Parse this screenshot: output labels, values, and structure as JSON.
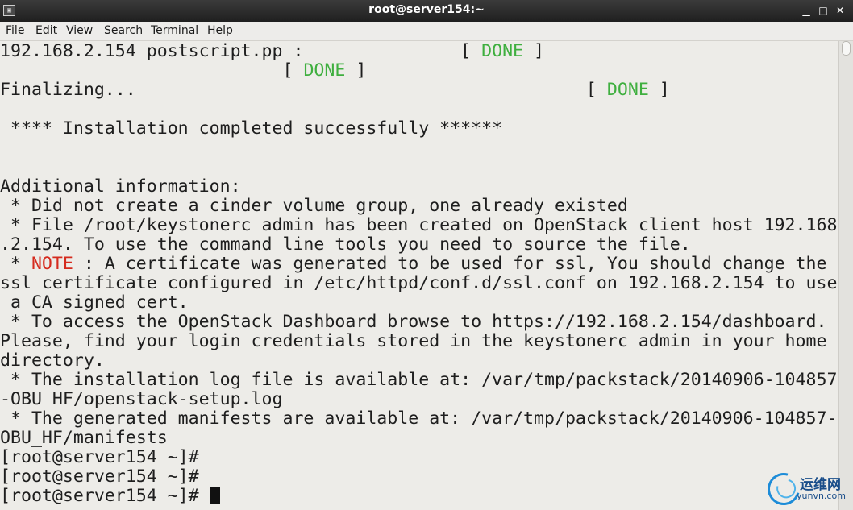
{
  "window": {
    "title": "root@server154:~",
    "app_icon_glyph": "▣",
    "minimize_glyph": "▁",
    "maximize_glyph": "□",
    "close_glyph": "✕"
  },
  "menubar": {
    "items": [
      "File",
      "Edit",
      "View",
      "Search",
      "Terminal",
      "Help"
    ]
  },
  "terminal": {
    "lines": {
      "l0": {
        "text": "192.168.2.154_postscript.pp :               [ ",
        "status": "DONE",
        "tail": " ]"
      },
      "l1": {
        "text": "                           [ ",
        "status": "DONE",
        "tail": " ]"
      },
      "l2": {
        "text": "Finalizing...                                           [ ",
        "status": "DONE",
        "tail": " ]"
      },
      "l4": " **** Installation completed successfully ******",
      "l7": "Additional information:",
      "l8": " * Did not create a cinder volume group, one already existed",
      "l9": " * File /root/keystonerc_admin has been created on OpenStack client host 192.168",
      "l10": ".2.154. To use the command line tools you need to source the file.",
      "l11": {
        "prefix": " * ",
        "note": "NOTE",
        "rest": " : A certificate was generated to be used for ssl, You should change the"
      },
      "l12": "ssl certificate configured in /etc/httpd/conf.d/ssl.conf on 192.168.2.154 to use",
      "l13": " a CA signed cert.",
      "l14": " * To access the OpenStack Dashboard browse to https://192.168.2.154/dashboard.",
      "l15": "Please, find your login credentials stored in the keystonerc_admin in your home",
      "l16": "directory.",
      "l17": " * The installation log file is available at: /var/tmp/packstack/20140906-104857",
      "l18": "-OBU_HF/openstack-setup.log",
      "l19": " * The generated manifests are available at: /var/tmp/packstack/20140906-104857-",
      "l20": "OBU_HF/manifests",
      "l21": "[root@server154 ~]#",
      "l22": "[root@server154 ~]#",
      "l23": "[root@server154 ~]# "
    },
    "colors": {
      "background": "#edece8",
      "text": "#1e1e1e",
      "done": "#3faf3f",
      "note": "#d52b1e"
    }
  },
  "watermark": {
    "cn": "运维网",
    "en": "yunvn.com"
  }
}
